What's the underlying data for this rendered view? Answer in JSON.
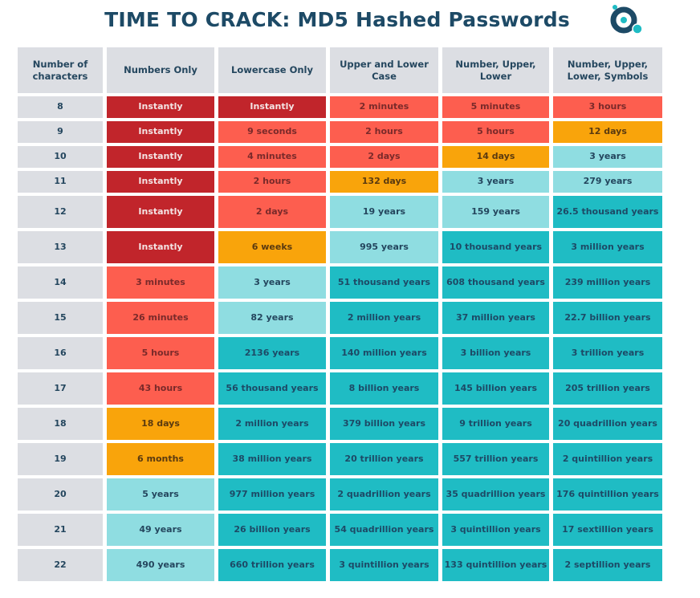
{
  "chart_data": {
    "type": "table",
    "title": "TIME TO CRACK: MD5 Hashed Passwords",
    "columns": [
      "Number of characters",
      "Numbers Only",
      "Lowercase Only",
      "Upper and Lower Case",
      "Number, Upper, Lower",
      "Number, Upper, Lower, Symbols"
    ],
    "legend": {
      "darkred": "#c1252b",
      "red": "#fd5e4f",
      "orange": "#f9a40b",
      "lightteal": "#8fdde1",
      "teal": "#1fbcc4"
    },
    "rows": [
      {
        "chars": "8",
        "values": [
          "Instantly",
          "Instantly",
          "2 minutes",
          "5 minutes",
          "3 hours"
        ],
        "colors": [
          "darkred",
          "darkred",
          "red",
          "red",
          "red"
        ]
      },
      {
        "chars": "9",
        "values": [
          "Instantly",
          "9 seconds",
          "2 hours",
          "5 hours",
          "12 days"
        ],
        "colors": [
          "darkred",
          "red",
          "red",
          "red",
          "orange"
        ]
      },
      {
        "chars": "10",
        "values": [
          "Instantly",
          "4 minutes",
          "2 days",
          "14 days",
          "3 years"
        ],
        "colors": [
          "darkred",
          "red",
          "red",
          "orange",
          "lightteal"
        ]
      },
      {
        "chars": "11",
        "values": [
          "Instantly",
          "2 hours",
          "132 days",
          "3 years",
          "279 years"
        ],
        "colors": [
          "darkred",
          "red",
          "orange",
          "lightteal",
          "lightteal"
        ]
      },
      {
        "chars": "12",
        "values": [
          "Instantly",
          "2 days",
          "19 years",
          "159 years",
          "26.5 thousand years"
        ],
        "colors": [
          "darkred",
          "red",
          "lightteal",
          "lightteal",
          "teal"
        ]
      },
      {
        "chars": "13",
        "values": [
          "Instantly",
          "6 weeks",
          "995 years",
          "10 thousand years",
          "3 million years"
        ],
        "colors": [
          "darkred",
          "orange",
          "lightteal",
          "teal",
          "teal"
        ]
      },
      {
        "chars": "14",
        "values": [
          "3 minutes",
          "3 years",
          "51 thousand years",
          "608 thousand years",
          "239 million years"
        ],
        "colors": [
          "red",
          "lightteal",
          "teal",
          "teal",
          "teal"
        ]
      },
      {
        "chars": "15",
        "values": [
          "26 minutes",
          "82 years",
          "2 million years",
          "37 million years",
          "22.7 billion years"
        ],
        "colors": [
          "red",
          "lightteal",
          "teal",
          "teal",
          "teal"
        ]
      },
      {
        "chars": "16",
        "values": [
          "5 hours",
          "2136 years",
          "140 million years",
          "3 billion years",
          "3 trillion years"
        ],
        "colors": [
          "red",
          "teal",
          "teal",
          "teal",
          "teal"
        ]
      },
      {
        "chars": "17",
        "values": [
          "43 hours",
          "56 thousand years",
          "8 billion years",
          "145  billion years",
          "205 trillion years"
        ],
        "colors": [
          "red",
          "teal",
          "teal",
          "teal",
          "teal"
        ]
      },
      {
        "chars": "18",
        "values": [
          "18 days",
          "2 million years",
          "379 billion years",
          "9 trillion years",
          "20 quadrillion years"
        ],
        "colors": [
          "orange",
          "teal",
          "teal",
          "teal",
          "teal"
        ]
      },
      {
        "chars": "19",
        "values": [
          "6 months",
          "38 million years",
          "20 trillion years",
          "557 trillion years",
          "2 quintillion years"
        ],
        "colors": [
          "orange",
          "teal",
          "teal",
          "teal",
          "teal"
        ]
      },
      {
        "chars": "20",
        "values": [
          "5 years",
          "977 million years",
          "2 quadrillion years",
          "35 quadrillion years",
          "176 quintillion years"
        ],
        "colors": [
          "lightteal",
          "teal",
          "teal",
          "teal",
          "teal"
        ]
      },
      {
        "chars": "21",
        "values": [
          "49 years",
          "26 billion years",
          "54 quadrillion years",
          "3 quintillion years",
          "17 sextillion years"
        ],
        "colors": [
          "lightteal",
          "teal",
          "teal",
          "teal",
          "teal"
        ]
      },
      {
        "chars": "22",
        "values": [
          "490 years",
          "660 trillion years",
          "3 quintillion years",
          "133 quintillion years",
          "2 septillion years"
        ],
        "colors": [
          "lightteal",
          "teal",
          "teal",
          "teal",
          "teal"
        ]
      }
    ]
  },
  "logo": {
    "icon": "brand-logo-icon",
    "ring_color": "#1d4a66",
    "dot_color": "#1fbcc4"
  }
}
